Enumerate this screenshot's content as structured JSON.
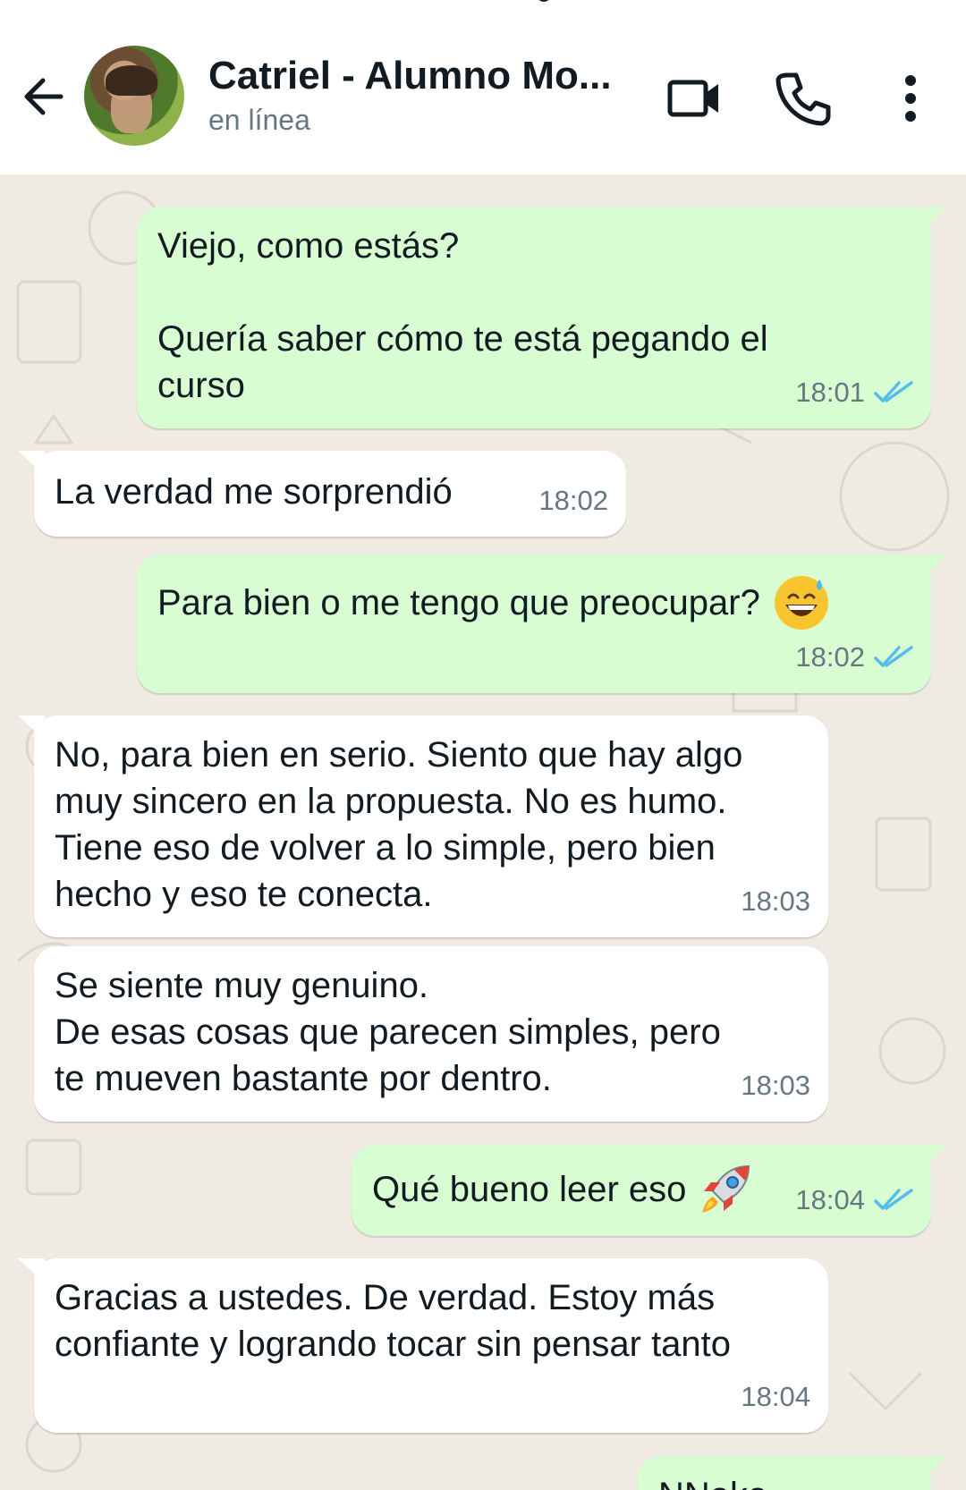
{
  "header": {
    "contact_name": "Catriel - Alumno Mo...",
    "status": "en línea"
  },
  "messages": [
    {
      "direction": "out",
      "text": "Viejo, como estás?\n\nQuería saber cómo te está pegando el\ncurso",
      "time": "18:01",
      "read": true
    },
    {
      "direction": "in",
      "text": "La verdad me sorprendió",
      "time": "18:02"
    },
    {
      "direction": "out",
      "text": "Para bien o me tengo que preocupar?",
      "emoji": "grinning-sweat-emoji",
      "time": "18:02",
      "read": true
    },
    {
      "direction": "in",
      "text": "No, para bien en serio. Siento que hay algo\nmuy sincero en la propuesta. No es humo.\nTiene eso de volver a lo simple, pero bien\nhecho y eso te conecta.",
      "time": "18:03"
    },
    {
      "direction": "in",
      "text": "Se siente muy genuino.\nDe esas cosas que parecen simples, pero\nte mueven bastante por dentro.",
      "time": "18:03"
    },
    {
      "direction": "out",
      "text": "Qué bueno leer eso",
      "emoji": "rocket-emoji",
      "time": "18:04",
      "read": true
    },
    {
      "direction": "in",
      "text": "Gracias a ustedes. De verdad. Estoy más\nconfiante y logrando tocar sin pensar tanto",
      "time": "18:04"
    },
    {
      "direction": "out",
      "text": "NNaka",
      "partial": true
    }
  ],
  "colors": {
    "outgoing_bubble": "#d9fdd3",
    "incoming_bubble": "#ffffff",
    "background": "#efeae2",
    "read_tick": "#53bdeb"
  }
}
